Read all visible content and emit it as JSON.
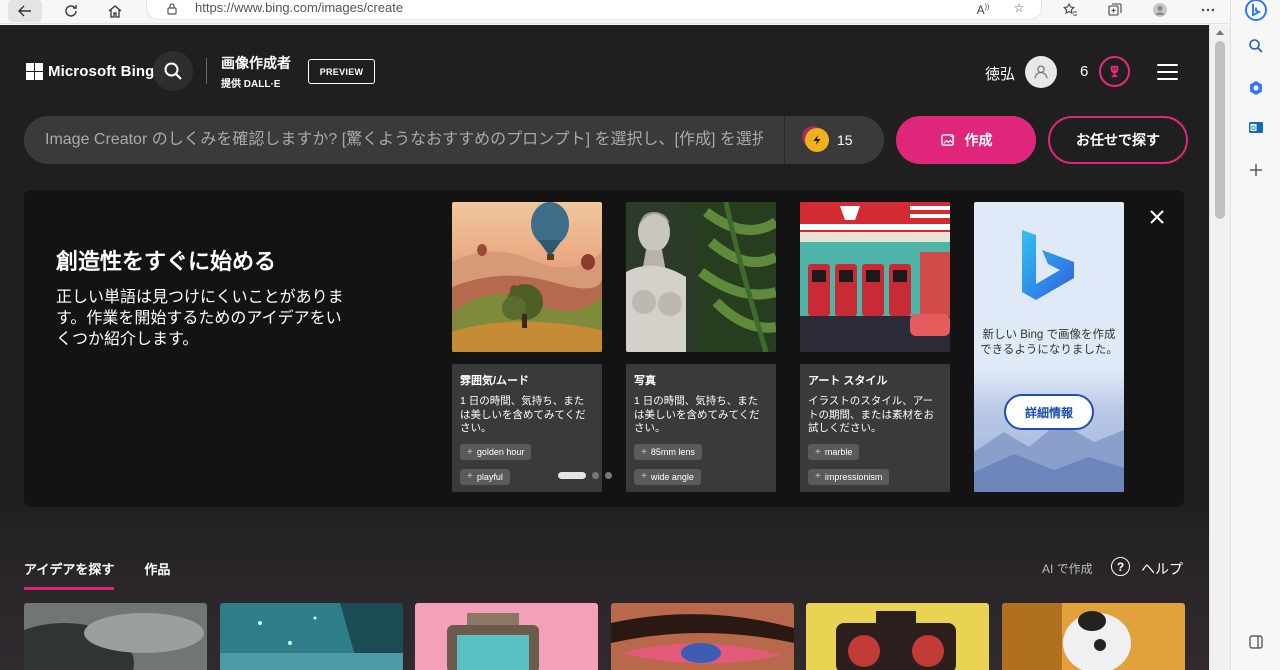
{
  "browser": {
    "url": "https://www.bing.com/images/create"
  },
  "header": {
    "logo_text": "Microsoft Bing",
    "product_title": "画像作成者",
    "product_subtitle": "提供 DALL·E",
    "preview_badge": "PREVIEW",
    "username": "徳弘",
    "reward_count": "6"
  },
  "prompt": {
    "placeholder": "Image Creator のしくみを確認しますか? [驚くようなおすすめのプロンプト] を選択し、[作成] を選択します",
    "boost_count": "15",
    "create_label": "作成",
    "surprise_label": "お任せで探す"
  },
  "onboarding": {
    "title": "創造性をすぐに始める",
    "description": "正しい単語は見つけにくいことがあります。作業を開始するためのアイデアをいくつか紹介します。",
    "cards": [
      {
        "title": "雰囲気/ムード",
        "text": "1 日の時間、気持ち、または美しいを含めてみてください。",
        "chips": [
          "golden hour",
          "playful"
        ]
      },
      {
        "title": "写真",
        "text": "1 日の時間、気持ち、または美しいを含めてみてください。",
        "chips": [
          "85mm lens",
          "wide angle"
        ]
      },
      {
        "title": "アート スタイル",
        "text": "イラストのスタイル、アートの期間、または素材をお試しください。",
        "chips": [
          "marble",
          "impressionism"
        ]
      }
    ],
    "promo_text": "新しい Bing で画像を作成できるようになりました。",
    "promo_button": "詳細情報"
  },
  "tabs": [
    {
      "label": "アイデアを探す",
      "active": true
    },
    {
      "label": "作品",
      "active": false
    }
  ],
  "toolbar": {
    "ai_link": "AI で作成",
    "help_label": "ヘルプ"
  },
  "colors": {
    "accent": "#e0267a",
    "background": "#1f1f1f",
    "panel": "#131313",
    "card_info": "#3a3a3a",
    "promo_button": "#1f4fb2"
  }
}
